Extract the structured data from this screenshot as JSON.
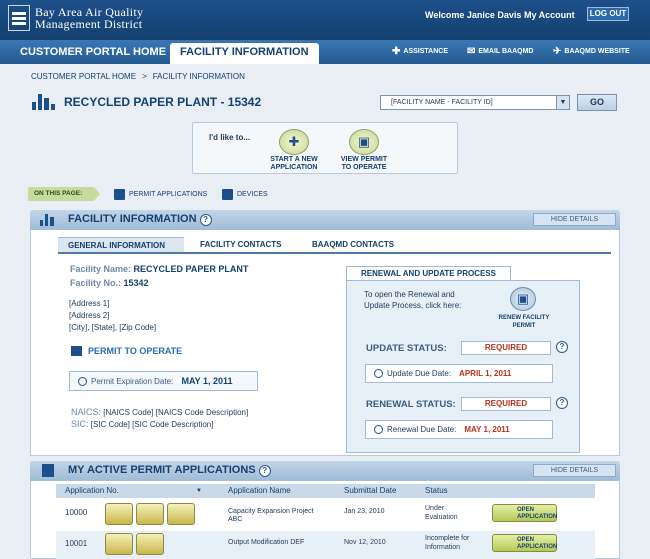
{
  "header": {
    "org_line1": "Bay Area Air Quality",
    "org_line2": "Management District",
    "welcome": "Welcome Janice Davis",
    "my_account": "My Account",
    "logout": "LOG OUT"
  },
  "nav": {
    "tabs": [
      {
        "label": "CUSTOMER PORTAL HOME"
      },
      {
        "label": "FACILITY INFORMATION"
      }
    ],
    "links": [
      {
        "label": "ASSISTANCE"
      },
      {
        "label": "EMAIL BAAQMD"
      },
      {
        "label": "BAAQMD WEBSITE"
      }
    ]
  },
  "breadcrumb": {
    "home": "CUSTOMER PORTAL HOME",
    "sep": ">",
    "current": "FACILITY INFORMATION"
  },
  "page": {
    "title": "RECYCLED PAPER PLANT - 15342",
    "select_value": "[FACILITY NAME - FACILITY ID]",
    "go": "GO"
  },
  "ilike": {
    "label": "I'd like to...",
    "start_line1": "START A NEW",
    "start_line2": "APPLICATION",
    "view_line1": "VIEW PERMIT",
    "view_line2": "TO OPERATE"
  },
  "onpage": {
    "label": "ON THIS PAGE:",
    "link1": "PERMIT APPLICATIONS",
    "link2": "DEVICES"
  },
  "facility": {
    "section_title": "FACILITY INFORMATION",
    "hide": "HIDE DETAILS",
    "tabs": [
      "GENERAL INFORMATION",
      "FACILITY CONTACTS",
      "BAAQMD CONTACTS"
    ],
    "name_label": "Facility Name:",
    "name": "RECYCLED PAPER PLANT",
    "no_label": "Facility No.:",
    "no": "15342",
    "address": [
      "[Address 1]",
      "[Address 2]",
      "[City], [State], [Zip Code]"
    ],
    "pto": "PERMIT TO OPERATE",
    "exp_label": "Permit Expiration Date:",
    "exp_date": "MAY 1, 2011",
    "naics_label": "NAICS:",
    "naics": "[NAICS Code]  [NAICS Code Description]",
    "sic_label": "SIC:",
    "sic": "[SIC Code]  [SIC Code Description]"
  },
  "renewal": {
    "title": "RENEWAL AND UPDATE PROCESS",
    "intro1": "To open the Renewal and",
    "intro2": "Update Process, click here:",
    "renew_line1": "RENEW FACILITY",
    "renew_line2": "PERMIT",
    "update_label": "UPDATE STATUS:",
    "update_status": "REQUIRED",
    "update_due_label": "Update Due Date:",
    "update_due": "APRIL 1, 2011",
    "renewal_label": "RENEWAL STATUS:",
    "renewal_status": "REQUIRED",
    "renewal_due_label": "Renewal Due Date:",
    "renewal_due": "MAY 1, 2011"
  },
  "apps": {
    "section_title": "MY ACTIVE PERMIT APPLICATIONS",
    "hide": "HIDE DETAILS",
    "headers": [
      "Application No.",
      "Application Name",
      "Submittal Date",
      "Status"
    ],
    "rows": [
      {
        "no": "10000",
        "name1": "Capacity Expansion Project",
        "name2": "ABC",
        "date": "Jan 23, 2010",
        "status1": "Under",
        "status2": "Evaluation",
        "btn1": "OPEN",
        "btn2": "APPLICATION"
      },
      {
        "no": "10001",
        "name1": "Output Modification DEF",
        "name2": "",
        "date": "Nov 12, 2010",
        "status1": "Incomplete for",
        "status2": "Information",
        "btn1": "OPEN",
        "btn2": "APPLICATION"
      }
    ]
  },
  "colors": {
    "primary": "#14416f",
    "accent": "#2a6fb1",
    "alert": "#b4341f",
    "onpage_bg": "#c7dc9c"
  }
}
